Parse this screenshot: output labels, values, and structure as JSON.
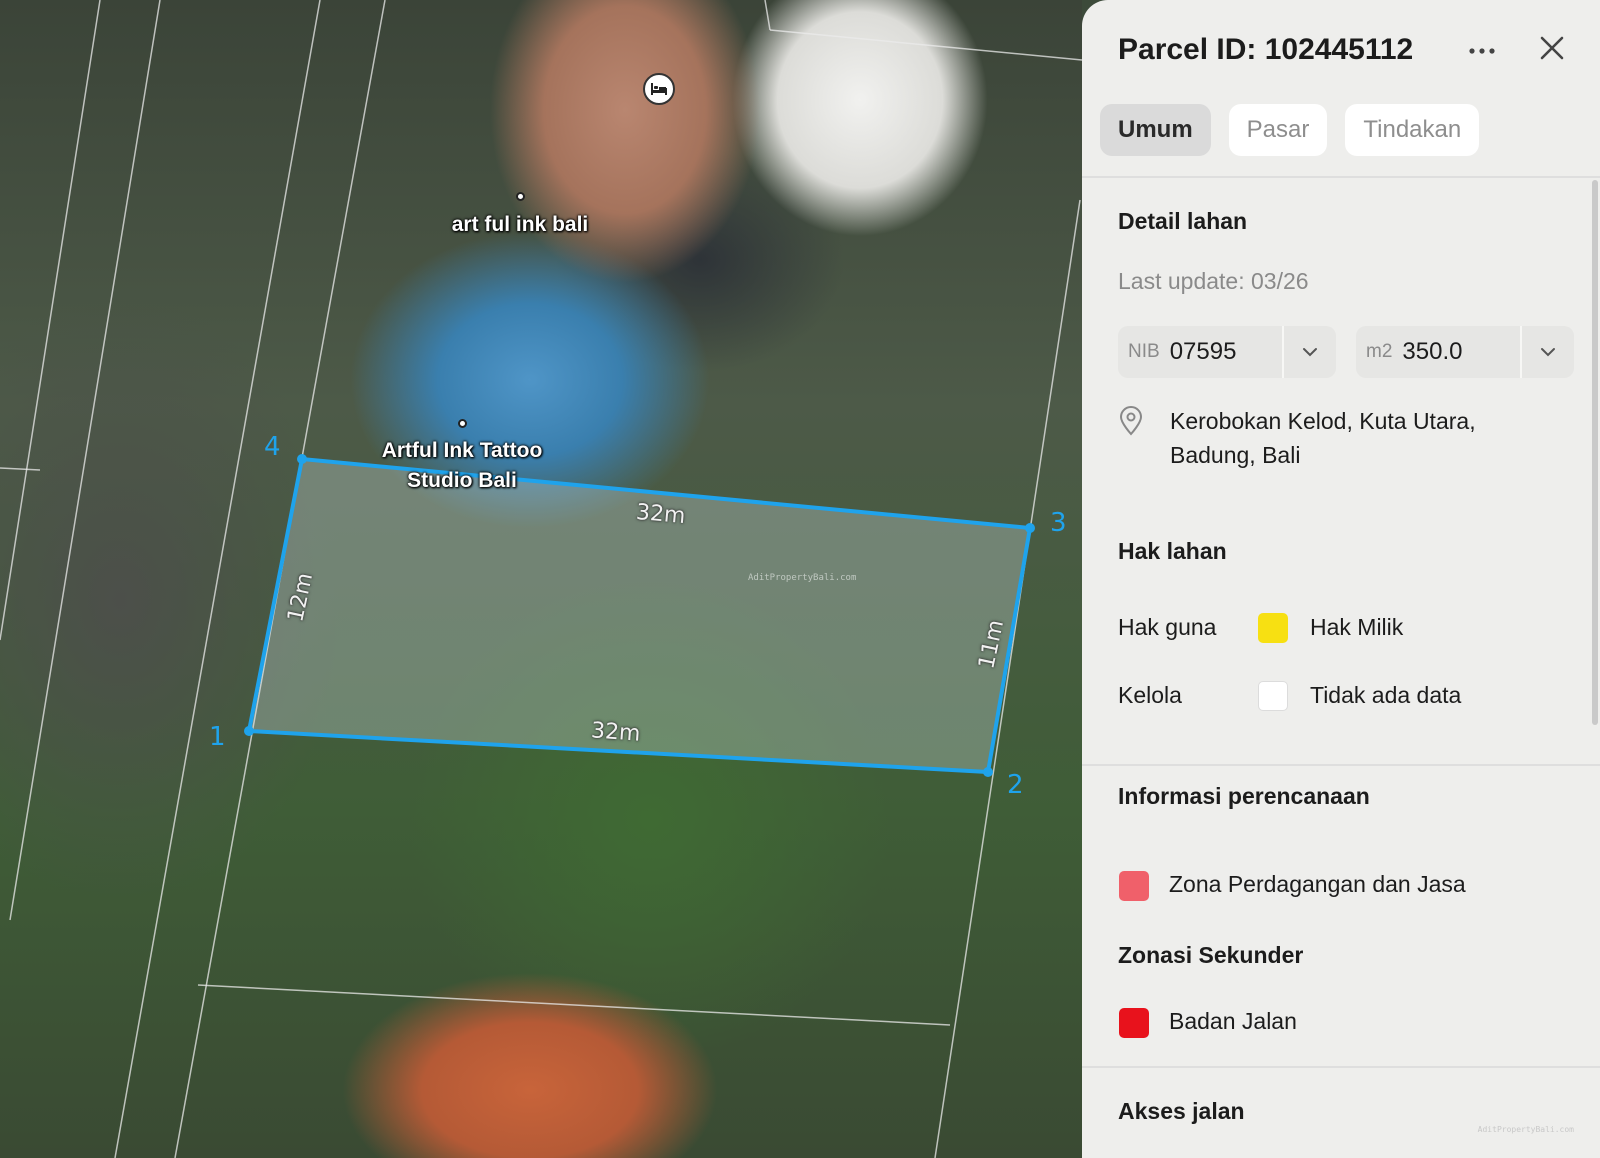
{
  "map": {
    "pois": [
      {
        "label": "art ful ink bali"
      },
      {
        "label": "Artful Ink Tattoo\nStudio Bali"
      }
    ],
    "hotel_icon": "bed-icon",
    "parcel": {
      "vertex_labels": [
        "1",
        "2",
        "3",
        "4"
      ],
      "edge_labels": {
        "top": "32m",
        "bottom": "32m",
        "left": "12m",
        "right": "11m"
      },
      "outline_color": "#1fa3ec"
    },
    "watermark": "AditPropertyBali.com"
  },
  "panel": {
    "title": "Parcel ID: 102445112",
    "more_icon": "more-horizontal-icon",
    "close_icon": "close-icon",
    "tabs": [
      {
        "label": "Umum",
        "active": true
      },
      {
        "label": "Pasar",
        "active": false
      },
      {
        "label": "Tindakan",
        "active": false
      }
    ],
    "detail": {
      "title": "Detail lahan",
      "last_update": "Last update: 03/26",
      "nib": {
        "prefix": "NIB",
        "value": "07595"
      },
      "area": {
        "prefix": "m2",
        "value": "350.0"
      },
      "location_icon": "map-pin-icon",
      "location": "Kerobokan Kelod, Kuta Utara,\nBadung, Bali"
    },
    "rights": {
      "title": "Hak lahan",
      "rows": [
        {
          "label": "Hak guna",
          "value": "Hak Milik",
          "color": "#f7e012"
        },
        {
          "label": "Kelola",
          "value": "Tidak ada data",
          "color": "#ffffff"
        }
      ]
    },
    "planning": {
      "title": "Informasi perencanaan",
      "zone": {
        "value": "Zona Perdagangan dan Jasa",
        "color": "#f0606a"
      },
      "secondary_title": "Zonasi Sekunder",
      "secondary": {
        "value": "Badan Jalan",
        "color": "#e8121c"
      }
    },
    "road_access": {
      "title": "Akses jalan"
    },
    "corner_watermark": "AditPropertyBali.com"
  }
}
